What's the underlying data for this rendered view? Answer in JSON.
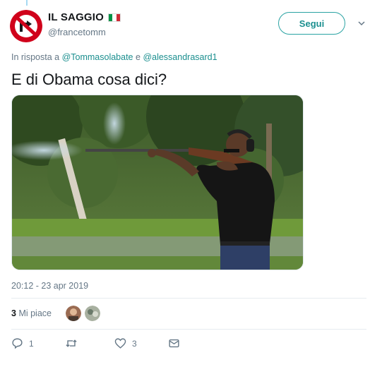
{
  "user": {
    "display_name": "IL SAGGIO",
    "handle": "@francetomm",
    "flag_icon": "italy-flag-icon",
    "flag_colors": [
      "#009246",
      "#ffffff",
      "#ce2b37"
    ]
  },
  "follow_button": {
    "label": "Segui"
  },
  "reply_context": {
    "prefix": "In risposta a",
    "mention1": "@Tommasolabate",
    "conjunction": "e",
    "mention2": "@alessandrasard1"
  },
  "tweet": {
    "text": "E di Obama cosa dici?",
    "timestamp": "20:12 - 23 apr 2019"
  },
  "stats": {
    "likes_count": "3",
    "likes_label": "Mi piace"
  },
  "actions": {
    "reply_count": "1",
    "retweet_count": "",
    "like_count": "3"
  },
  "colors": {
    "accent": "#1b8f8f",
    "secondary_text": "#657786",
    "avatar_red": "#d0021b"
  }
}
